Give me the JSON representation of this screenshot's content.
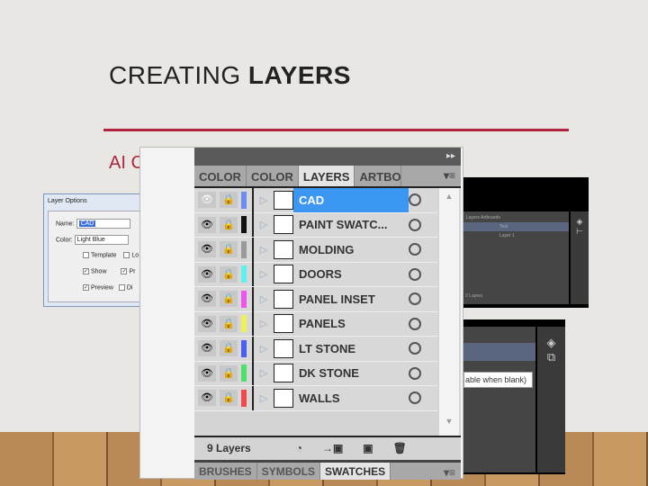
{
  "slide": {
    "title_a": "CREATING ",
    "title_b": "LAYERS",
    "subtitle": "AI C",
    "subtitle_end": ")"
  },
  "dialog": {
    "title": "Layer Options",
    "name_label": "Name:",
    "name_value": "CAD",
    "color_label": "Color:",
    "color_value": "Light Blue",
    "template": "Template",
    "show": "Show",
    "preview": "Preview",
    "lock_partial": "Lo",
    "print_partial": "Pr",
    "dim_partial": "Di"
  },
  "panel": {
    "tabs": [
      "COLOR",
      "COLOR",
      "LAYERS",
      "ARTBO"
    ],
    "active_tab": "LAYERS",
    "layers": [
      {
        "name": "CAD",
        "color": "#6b8cf0",
        "selected": true
      },
      {
        "name": "PAINT SWATC...",
        "color": "#111111"
      },
      {
        "name": "MOLDING",
        "color": "#9a9a9a"
      },
      {
        "name": "DOORS",
        "color": "#5ff0f0"
      },
      {
        "name": "PANEL INSET",
        "color": "#ee55ee"
      },
      {
        "name": "PANELS",
        "color": "#f0f05a"
      },
      {
        "name": "LT STONE",
        "color": "#4a5ef0"
      },
      {
        "name": "DK STONE",
        "color": "#4ee06a"
      },
      {
        "name": "WALLS",
        "color": "#f04a4a"
      }
    ],
    "count": "9 Layers",
    "bottom_tabs": [
      "BRUSHES",
      "SYMBOLS",
      "SWATCHES"
    ]
  },
  "cc_panel": {
    "tabs": [
      "Layers",
      "Artboards"
    ],
    "layers": [
      "Text",
      "Layer 1"
    ],
    "count": "2 Layers"
  },
  "tooltip": "able when blank)"
}
